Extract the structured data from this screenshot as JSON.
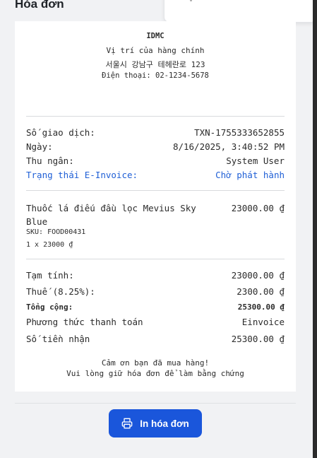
{
  "dialog": {
    "title": "Hóa đơn"
  },
  "receipt": {
    "store_name": "IDMC",
    "address_line1": "Vị trí của hàng chính",
    "address_line2": "서울시 강남구 테헤란로 123",
    "phone": "Điện thoại: 02-1234-5678",
    "transaction": {
      "label": "Số giao dịch:",
      "value": "TXN-1755333652855"
    },
    "date": {
      "label": "Ngày:",
      "value": "8/16/2025, 3:40:52 PM"
    },
    "cashier": {
      "label": "Thu ngân:",
      "value": "System User"
    },
    "einvoice": {
      "label": "Trạng thái E-Invoice:",
      "value": "Chờ phát hành",
      "color": "#1f5fd6"
    },
    "item": {
      "name": "Thuốc lá điếu đầu lọc Mevius Sky Blue",
      "price": "23000.00 ₫",
      "sku": "SKU: FOOD00431",
      "qty_line": "1 x 23000 ₫"
    },
    "subtotal": {
      "label": "Tạm tính:",
      "value": "23000.00 ₫"
    },
    "tax": {
      "label": "Thuế (8.25%):",
      "value": "2300.00 ₫"
    },
    "total": {
      "label": "Tổng cộng:",
      "value": "25300.00 ₫"
    },
    "payment_method": {
      "label": "Phương thức thanh toán",
      "value": "Einvoice"
    },
    "amount_received": {
      "label": "Số tiền nhận",
      "value": "25300.00 ₫"
    },
    "thanks_line1": "Cảm ơn bạn đã mua hàng!",
    "thanks_line2": "Vui lòng giữ hóa đơn để làm bằng chứng"
  },
  "actions": {
    "print_label": "In hóa đơn",
    "print_icon": "printer-icon",
    "accent": "#1a56db"
  }
}
